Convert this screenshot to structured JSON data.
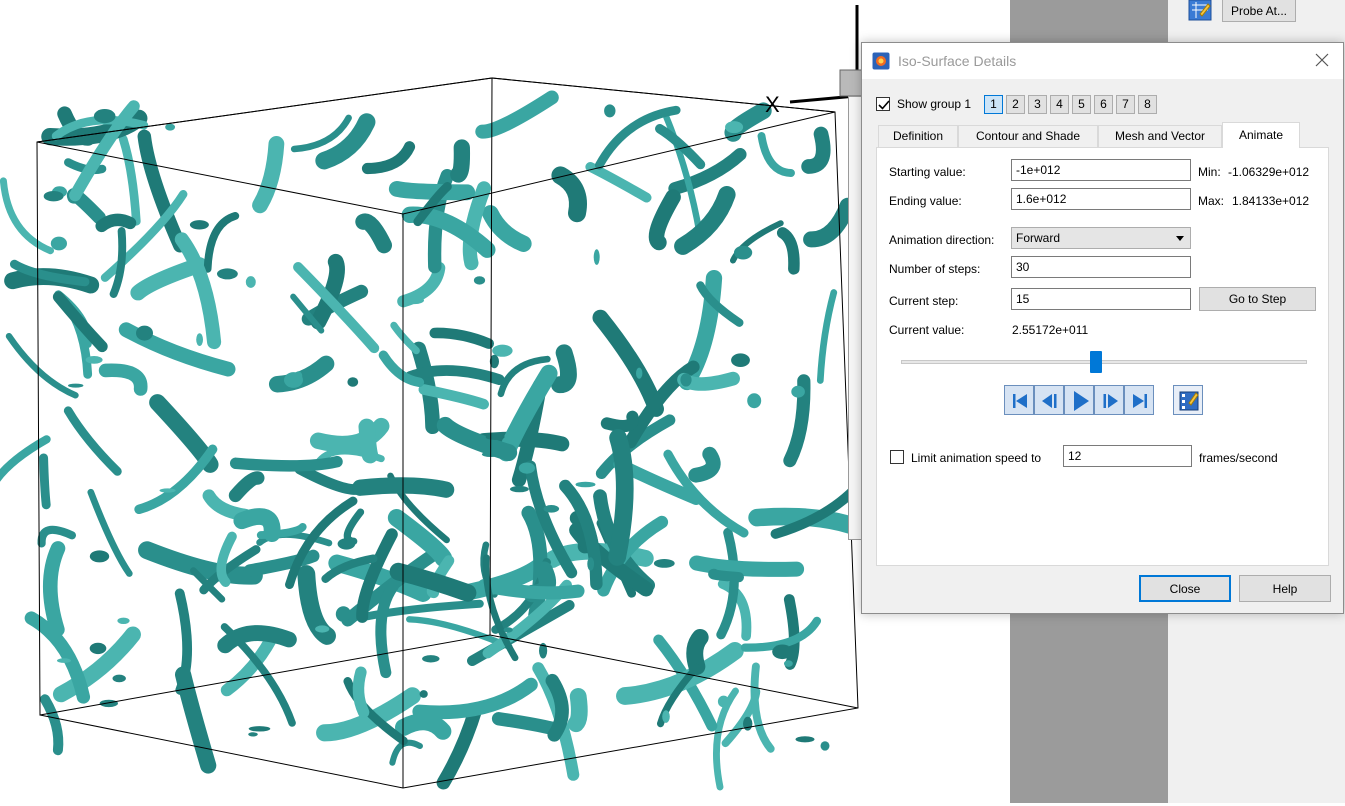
{
  "viewport": {
    "axis_label": "X"
  },
  "right_panel": {
    "probe_button": "Probe At..."
  },
  "dialog": {
    "title": "Iso-Surface Details",
    "show_group_label": "Show group 1",
    "show_group_checked": true,
    "groups": [
      "1",
      "2",
      "3",
      "4",
      "5",
      "6",
      "7",
      "8"
    ],
    "active_group": "1",
    "tabs": [
      "Definition",
      "Contour and Shade",
      "Mesh and Vector",
      "Animate"
    ],
    "active_tab": "Animate",
    "animate": {
      "starting_value_label": "Starting value:",
      "starting_value": "-1e+012",
      "min_label": "Min:",
      "min_value": "-1.06329e+012",
      "ending_value_label": "Ending value:",
      "ending_value": "1.6e+012",
      "max_label": "Max:",
      "max_value": "1.84133e+012",
      "direction_label": "Animation direction:",
      "direction_value": "Forward",
      "steps_label": "Number of steps:",
      "steps_value": "30",
      "current_step_label": "Current step:",
      "current_step_value": "15",
      "go_to_step": "Go to Step",
      "current_value_label": "Current value:",
      "current_value": "2.55172e+011",
      "slider_fraction": 0.5,
      "limit_speed_label": "Limit animation speed to",
      "limit_speed_checked": false,
      "limit_speed_value": "12",
      "frames_label": "frames/second"
    },
    "close_button": "Close",
    "help_button": "Help"
  },
  "colors": {
    "surface": "#2a8f8c",
    "accent": "#0078d7"
  }
}
